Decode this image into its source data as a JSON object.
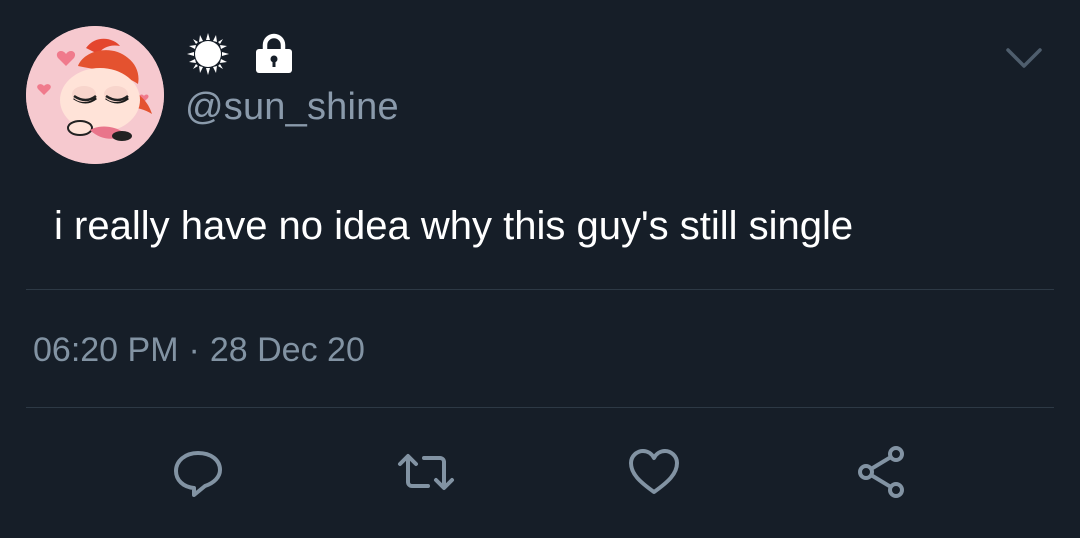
{
  "account": {
    "handle": "@sun_shine",
    "name_icons": [
      "sun-icon",
      "lock-icon"
    ],
    "avatar": "avatar"
  },
  "tweet": {
    "text": "i really have no idea why this guy's still single"
  },
  "timestamp": {
    "time": "06:20 PM",
    "separator": "·",
    "date": "28 Dec 20"
  },
  "actions": [
    {
      "icon": "reply-icon"
    },
    {
      "icon": "retweet-icon"
    },
    {
      "icon": "like-icon"
    },
    {
      "icon": "share-icon"
    }
  ],
  "colors": {
    "background": "#161e28",
    "text": "#ffffff",
    "secondary_text": "#8a9aab",
    "divider": "#2d3945",
    "icon": "#8293a3"
  }
}
